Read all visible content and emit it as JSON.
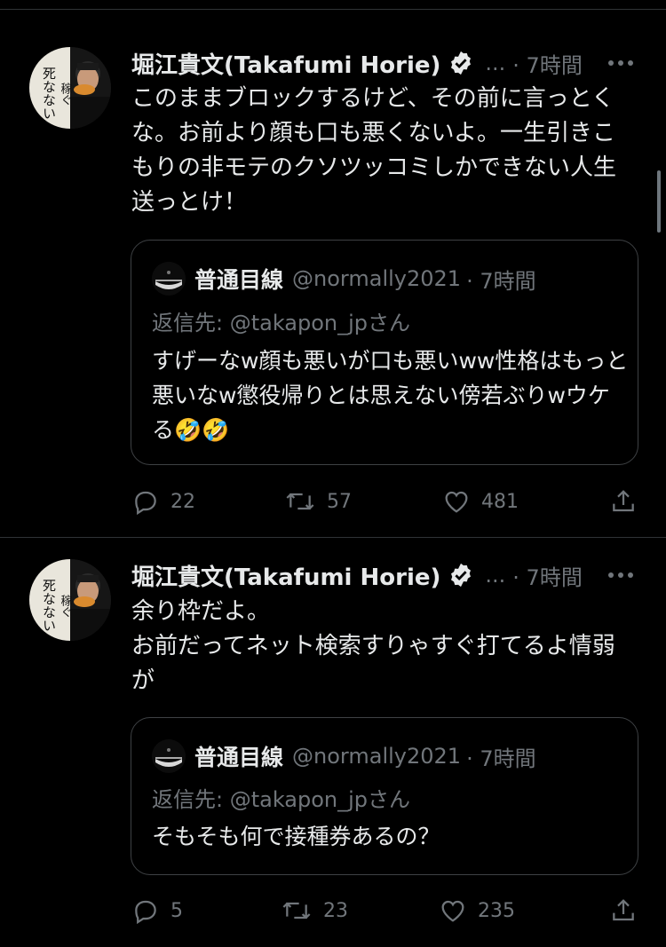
{
  "tweets": [
    {
      "author_name": "堀江貴文(Takafumi Horie)",
      "handle_ellipsis": "...",
      "time": "· 7時間",
      "text": "このままブロックするけど、その前に言っとくな。お前より顔も口も悪くないよ。一生引きこもりの非モテのクソツッコミしかできない人生送っとけ！",
      "quote": {
        "author_name": "普通目線",
        "handle": "@normally2021",
        "time": "· 7時間",
        "reply_to": "返信先: @takapon_jpさん",
        "text": "すげーなw顔も悪いが口も悪いww性格はもっと悪いなw懲役帰りとは思えない傍若ぶりwウケる🤣🤣"
      },
      "replies": "22",
      "retweets": "57",
      "likes": "481"
    },
    {
      "author_name": "堀江貴文(Takafumi Horie)",
      "handle_ellipsis": "...",
      "time": "· 7時間",
      "text": "余り枠だよ。\nお前だってネット検索すりゃすぐ打てるよ情弱が",
      "quote": {
        "author_name": "普通目線",
        "handle": "@normally2021",
        "time": "· 7時間",
        "reply_to": "返信先: @takapon_jpさん",
        "text": "そもそも何で接種券あるの？"
      },
      "replies": "5",
      "retweets": "23",
      "likes": "235"
    }
  ],
  "avatar_book_text": "死なないように稼ぐ。",
  "colors": {
    "background": "#000000",
    "text": "#e7e9ea",
    "muted": "#71767b",
    "border": "#2f3336"
  }
}
